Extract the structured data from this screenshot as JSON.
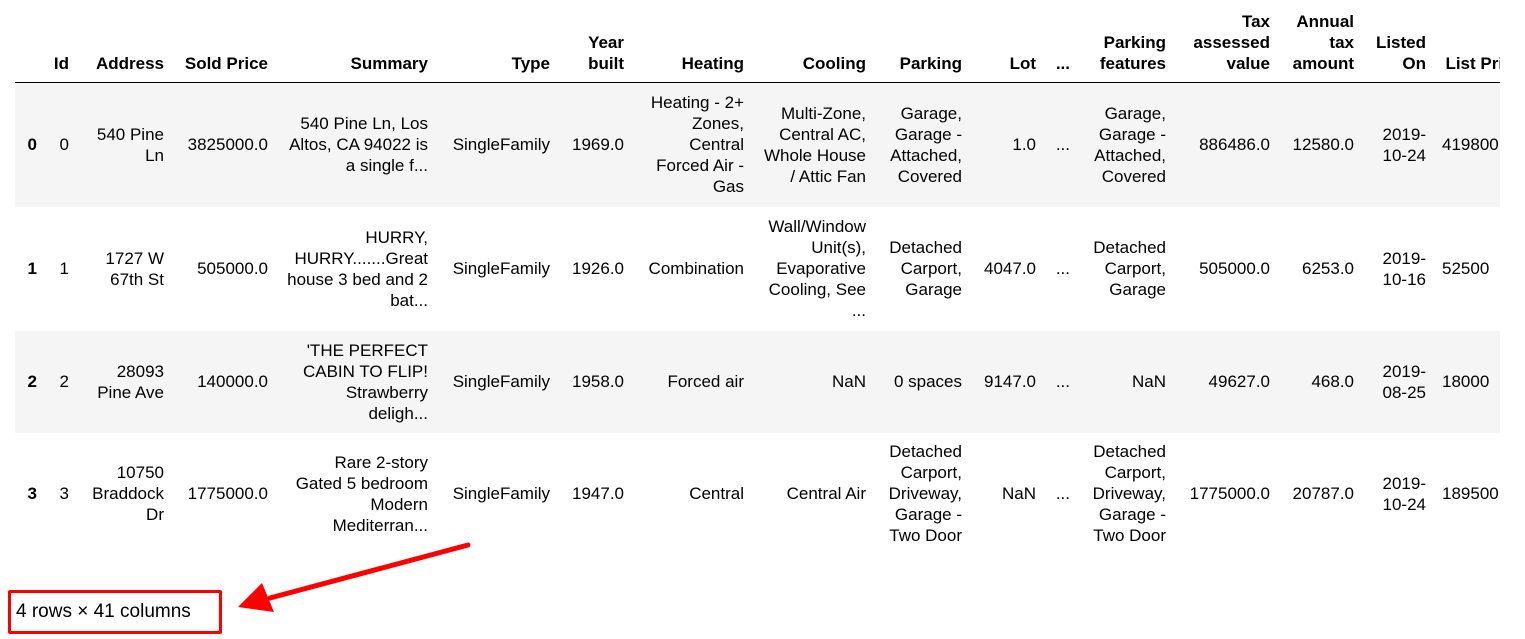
{
  "table": {
    "columns": [
      "",
      "Id",
      "Address",
      "Sold Price",
      "Summary",
      "Type",
      "Year built",
      "Heating",
      "Cooling",
      "Parking",
      "Lot",
      "...",
      "Parking features",
      "Tax assessed value",
      "Annual tax amount",
      "Listed On",
      "List Price"
    ],
    "rows": [
      [
        "0",
        "0",
        "540 Pine Ln",
        "3825000.0",
        "540 Pine Ln, Los Altos, CA 94022 is a single f...",
        "SingleFamily",
        "1969.0",
        "Heating - 2+ Zones, Central Forced Air - Gas",
        "Multi-Zone, Central AC, Whole House / Attic Fan",
        "Garage, Garage - Attached, Covered",
        "1.0",
        "...",
        "Garage, Garage - Attached, Covered",
        "886486.0",
        "12580.0",
        "2019-10-24",
        "419800"
      ],
      [
        "1",
        "1",
        "1727 W 67th St",
        "505000.0",
        "HURRY, HURRY.......Great house 3 bed and 2 bat...",
        "SingleFamily",
        "1926.0",
        "Combination",
        "Wall/Window Unit(s), Evaporative Cooling, See ...",
        "Detached Carport, Garage",
        "4047.0",
        "...",
        "Detached Carport, Garage",
        "505000.0",
        "6253.0",
        "2019-10-16",
        "52500"
      ],
      [
        "2",
        "2",
        "28093 Pine Ave",
        "140000.0",
        "'THE PERFECT CABIN TO FLIP! Strawberry deligh...",
        "SingleFamily",
        "1958.0",
        "Forced air",
        "NaN",
        "0 spaces",
        "9147.0",
        "...",
        "NaN",
        "49627.0",
        "468.0",
        "2019-08-25",
        "18000"
      ],
      [
        "3",
        "3",
        "10750 Braddock Dr",
        "1775000.0",
        "Rare 2-story Gated 5 bedroom Modern Mediterran...",
        "SingleFamily",
        "1947.0",
        "Central",
        "Central Air",
        "Detached Carport, Driveway, Garage - Two Door",
        "NaN",
        "...",
        "Detached Carport, Driveway, Garage - Two Door",
        "1775000.0",
        "20787.0",
        "2019-10-24",
        "189500"
      ]
    ]
  },
  "footer": {
    "shape_text": "4 rows × 41 columns"
  },
  "annotation": {
    "color": "#ff0000"
  }
}
